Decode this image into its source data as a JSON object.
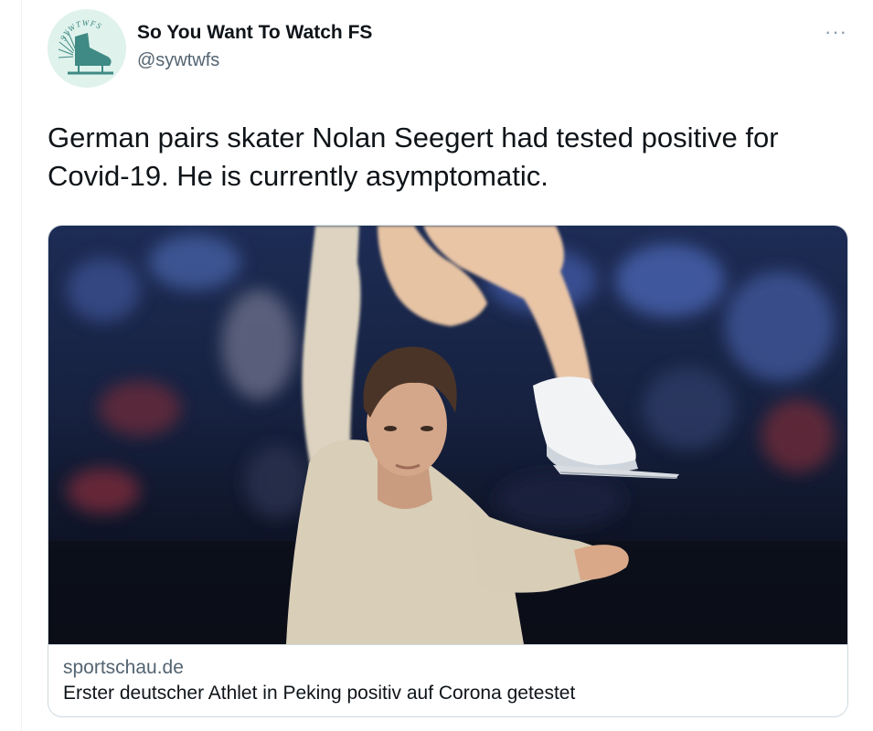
{
  "author": {
    "display_name": "So You Want To Watch FS",
    "handle": "@sywtwfs",
    "avatar_text": "SYWTWFS"
  },
  "menu": {
    "more_icon": "more-horizontal-icon",
    "more_glyph": "···"
  },
  "tweet": {
    "text": "German pairs skater Nolan Seegert had tested positive for Covid-19. He is currently asymptomatic."
  },
  "card": {
    "domain": "sportschau.de",
    "title": "Erster deutscher Athlet in Peking positiv auf Corona getestet"
  },
  "colors": {
    "text": "#0f1419",
    "secondary": "#536471",
    "border": "#cfd9de",
    "avatar_bg": "#dff2ec",
    "avatar_teal": "#3f8a84"
  }
}
